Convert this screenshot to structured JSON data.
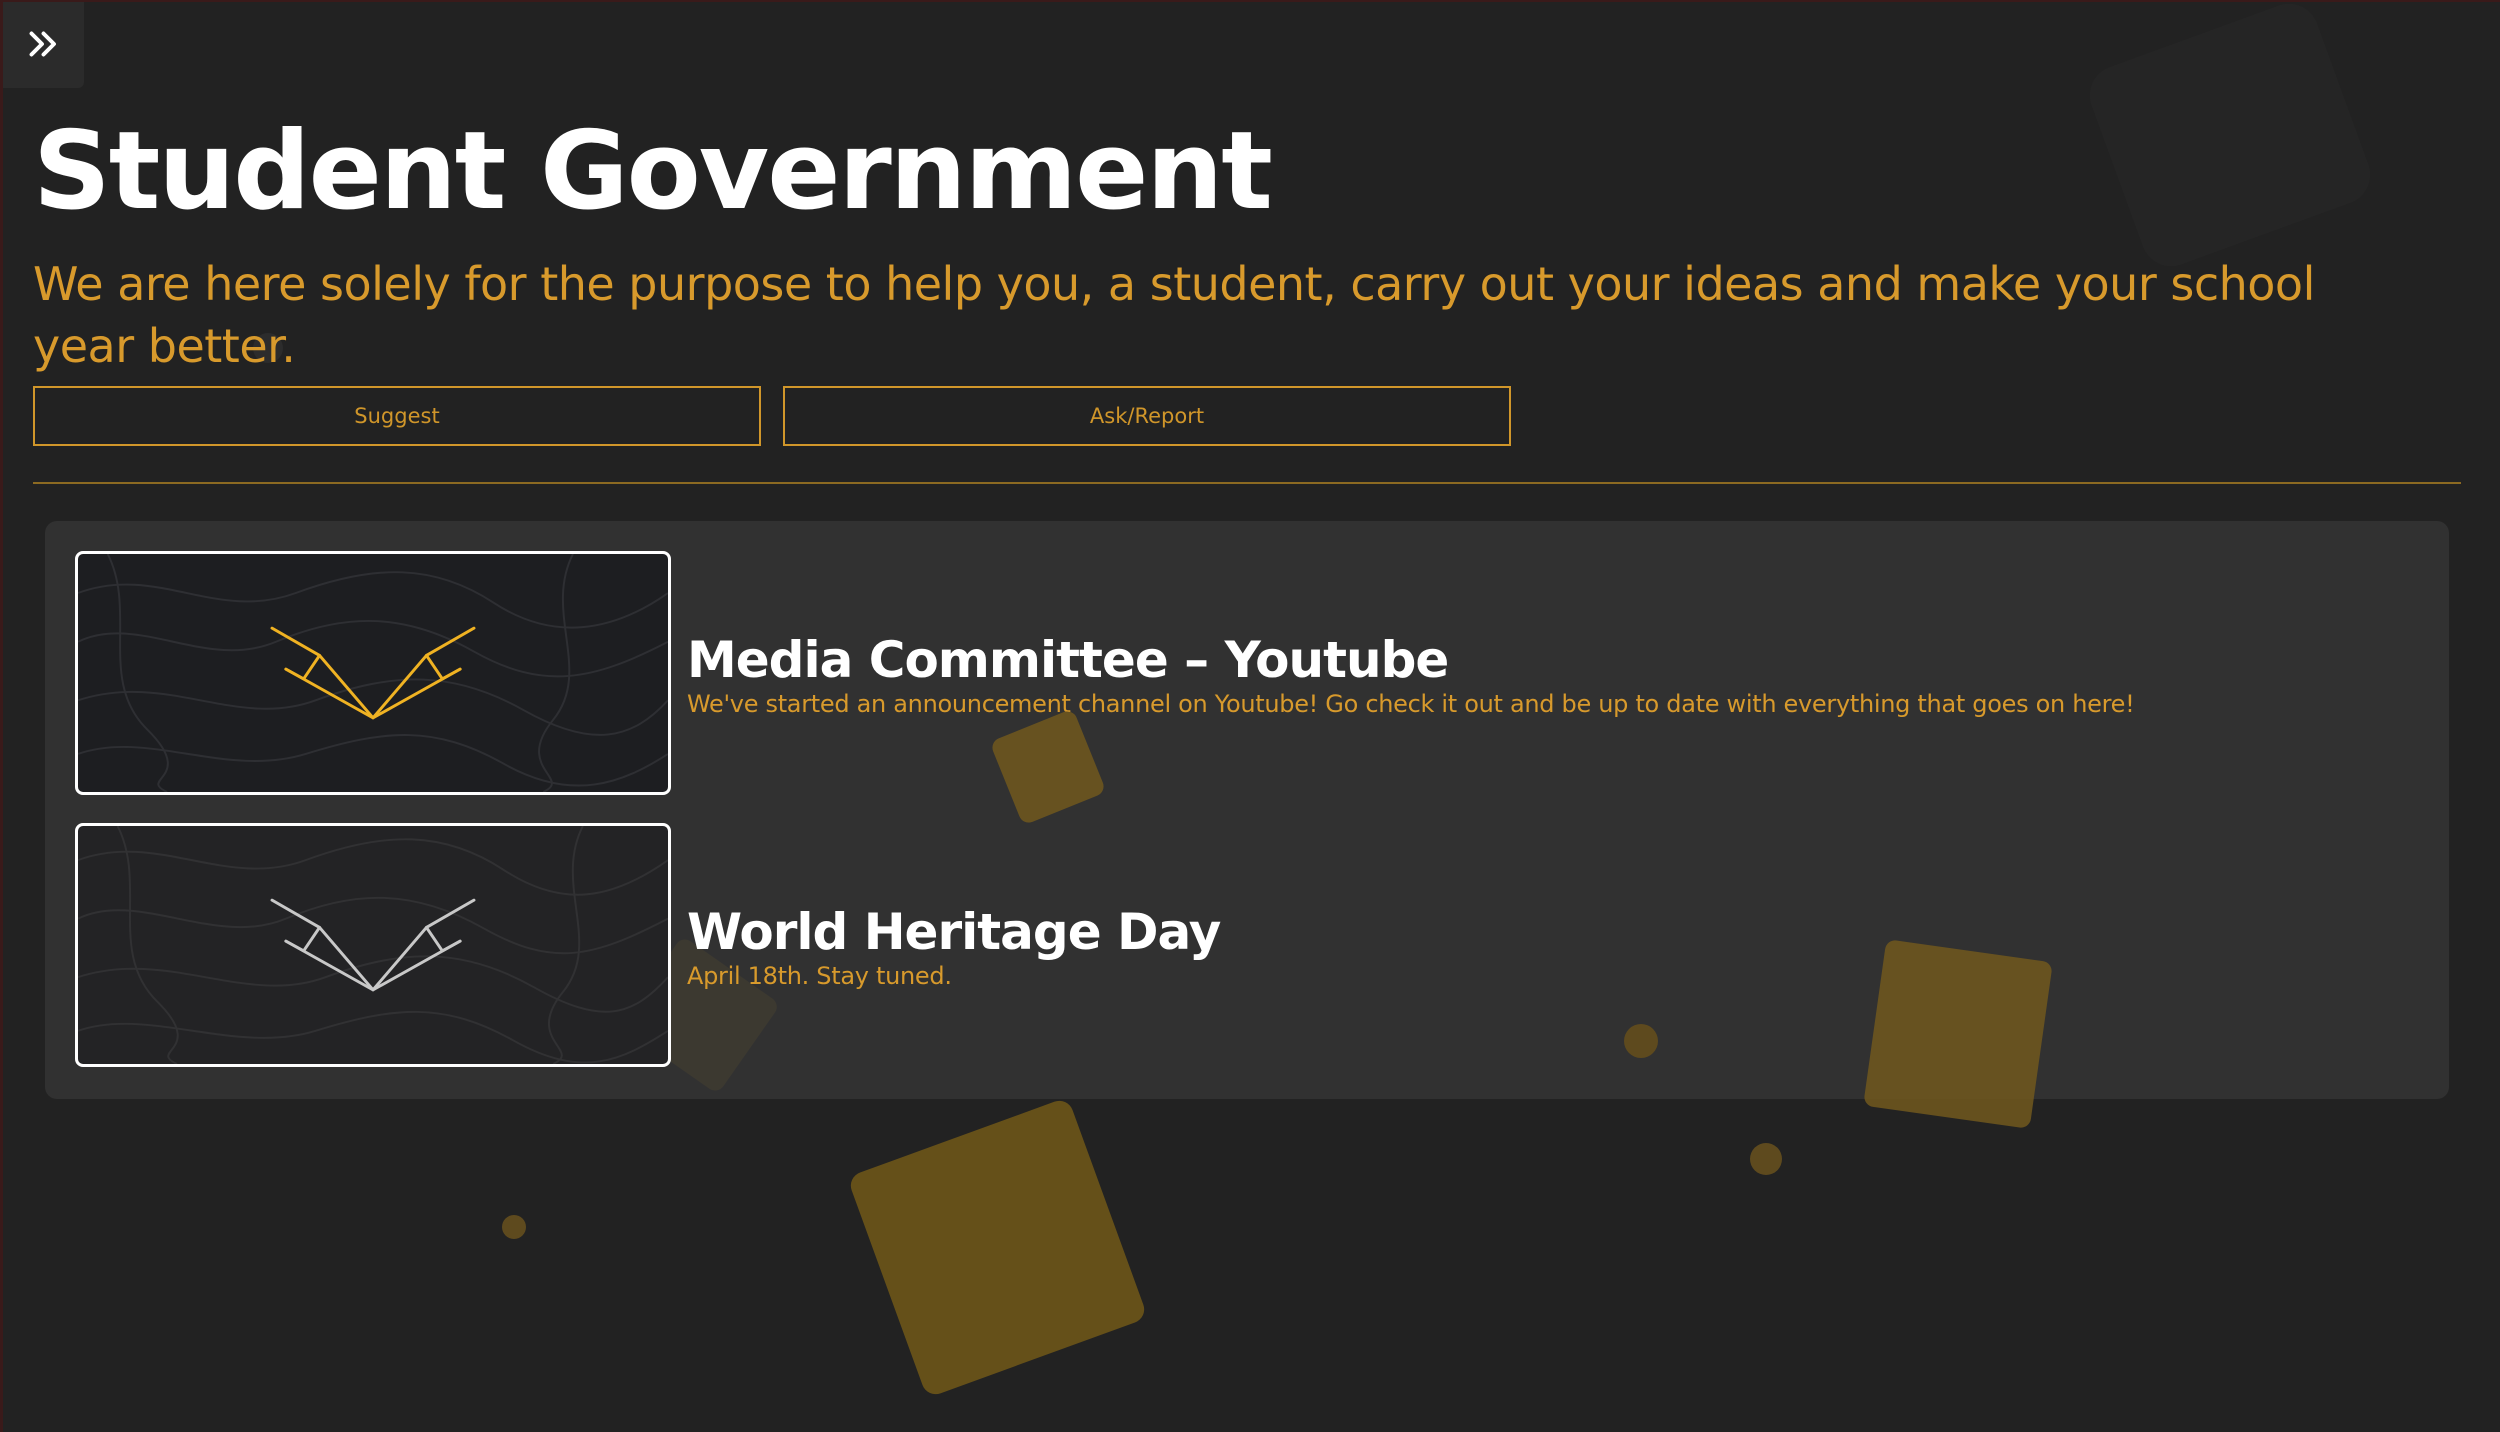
{
  "header": {
    "title": "Student Government",
    "subtitle": "We are here solely for the purpose to help you, a student, carry out your ideas and make your school year better."
  },
  "nav": {
    "toggle_icon": "double-chevron-right-icon"
  },
  "actions": {
    "suggest_label": "Suggest",
    "ask_report_label": "Ask/Report"
  },
  "posts": [
    {
      "title": "Media Committee – Youtube",
      "description": "We've started an announcement channel on Youtube! Go check it out and be up to date with everything that goes on here!",
      "logo_color": "#f0b323"
    },
    {
      "title": "World Heritage Day",
      "description": "April 18th. Stay tuned.",
      "logo_color": "#c8c8c8"
    }
  ],
  "theme": {
    "background": "#222222",
    "accent": "#d89a2c",
    "panel": "#343434",
    "text": "#ffffff"
  }
}
